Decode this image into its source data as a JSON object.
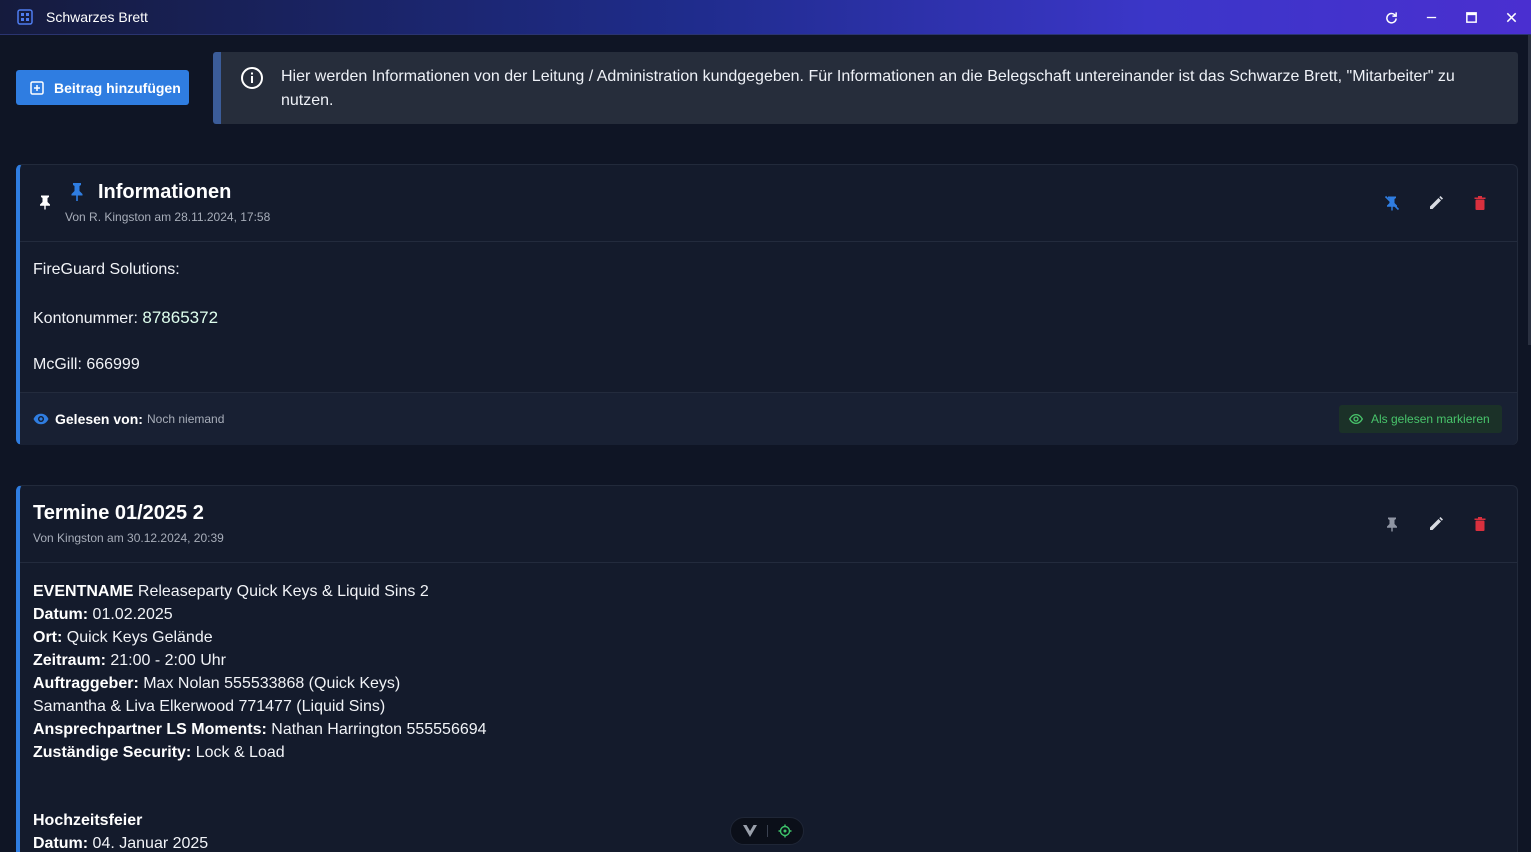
{
  "window": {
    "title": "Schwarzes Brett",
    "icon": "grid-app-icon",
    "controls": [
      "refresh-icon",
      "minimize-icon",
      "maximize-icon",
      "close-icon"
    ]
  },
  "toolbar": {
    "add_label": "Beitrag hinzufügen"
  },
  "banner": {
    "icon": "info-icon",
    "text": "Hier werden Informationen von der Leitung / Administration kundgegeben. Für Informationen an die Belegschaft untereinander ist das Schwarze Brett, \"Mitarbeiter\" zu nutzen."
  },
  "posts": [
    {
      "pinned": true,
      "title": "Informationen",
      "meta": "Von R. Kingston am 28.11.2024, 17:58",
      "lines": {
        "l1": "FireGuard Solutions:",
        "l2_label": "Kontonummer: ",
        "l2_value": "87865372",
        "l3": "McGill: 666999"
      },
      "read_by_label": "Gelesen von:",
      "read_by_value": "Noch niemand",
      "mark_read_label": "Als gelesen markieren"
    },
    {
      "pinned": false,
      "title": "Termine 01/2025 2",
      "meta": "Von Kingston am 30.12.2024, 20:39",
      "rows": [
        {
          "label": "EVENTNAME",
          "value": " Releaseparty Quick Keys & Liquid Sins 2"
        },
        {
          "label": "Datum:",
          "value": " 01.02.2025"
        },
        {
          "label": "Ort:",
          "value": " Quick Keys Gelände"
        },
        {
          "label": "Zeitraum:",
          "value": " 21:00 - 2:00 Uhr"
        },
        {
          "label": "Auftraggeber:",
          "value": " Max Nolan 555533868 (Quick Keys)"
        },
        {
          "label": "",
          "value": "Samantha & Liva Elkerwood 771477 (Liquid Sins)"
        },
        {
          "label": "Ansprechpartner LS Moments:",
          "value": " Nathan Harrington 555556694"
        },
        {
          "label": "Zuständige Security:",
          "value": " Lock & Load"
        }
      ],
      "rows2": [
        {
          "label": "Hochzeitsfeier",
          "value": ""
        },
        {
          "label": "Datum:",
          "value": " 04. Januar 2025"
        }
      ]
    }
  ],
  "colors": {
    "accent": "#2f7de1",
    "danger": "#d9303e",
    "success": "#48c46b",
    "background": "#0f1525",
    "card": "#141b2c"
  }
}
